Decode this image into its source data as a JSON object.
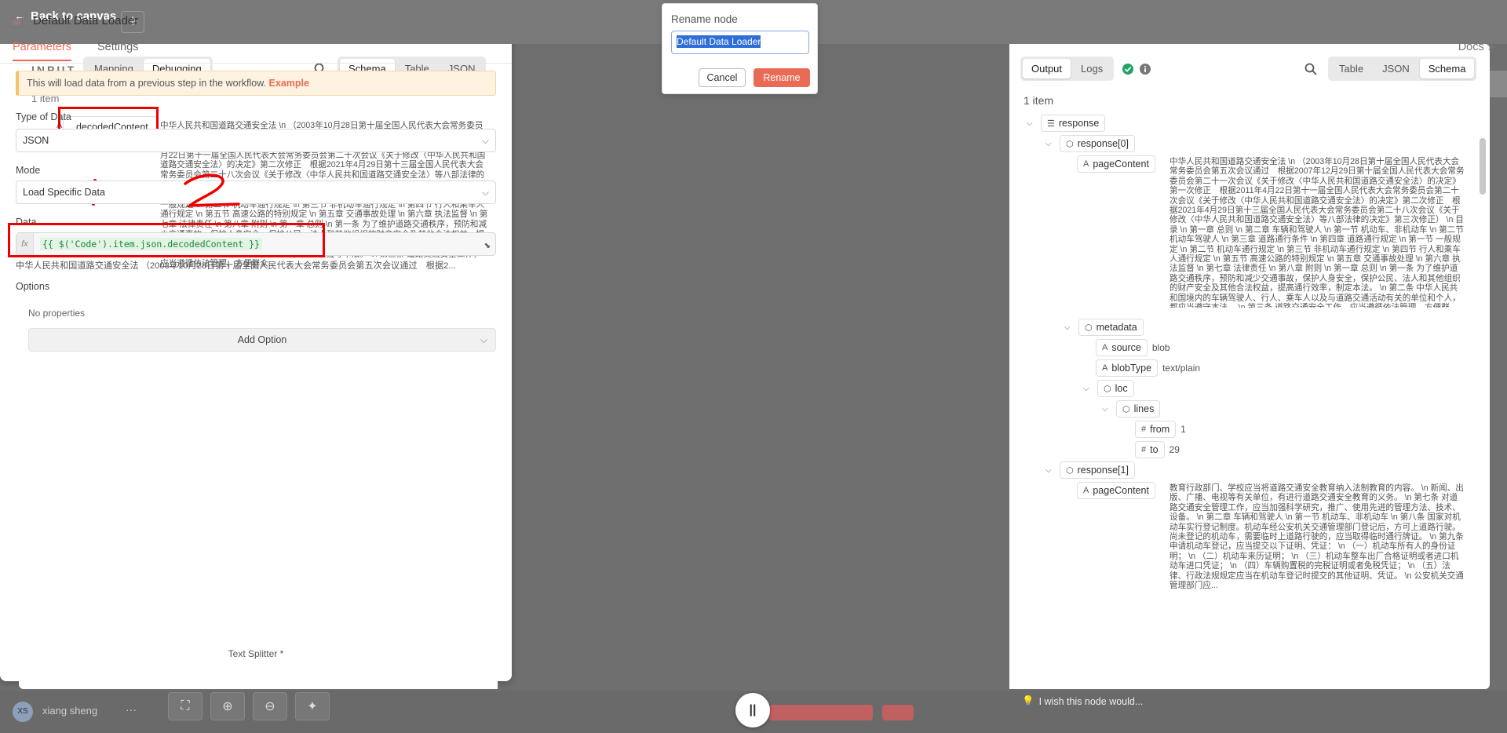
{
  "canvas": {
    "back_label": "Back to canvas",
    "add_label": "+",
    "user_initials": "XS",
    "user_name": "xiang sheng",
    "user_menu": "···",
    "wish_text": "I wish this node would..."
  },
  "input": {
    "title": "INPUT",
    "mode_tabs": [
      "Mapping",
      "Debugging"
    ],
    "active_mode": "Debugging",
    "view_tabs": [
      "Schema",
      "Table",
      "JSON"
    ],
    "active_view": "Schema",
    "item_count": "1 item",
    "key": "decodedContent",
    "value": "中华人民共和国道路交通安全法 \\n （2003年10月28日第十届全国人民代表大会常务委员会第五次会议通过　根据2007年12月29日第十届全国人民代表大会常务委员会第二十一次会议《关于修改〈中华人民共和国道路交通安全法〉的决定》第一次修正　根据2011年4月22日第十一届全国人民代表大会常务委员会第二十次会议《关于修改〈中华人民共和国道路交通安全法〉的决定》第二次修正　根据2021年4月29日第十三届全国人民代表大会常务委员会第二十八次会议《关于修改〈中华人民共和国道路交通安全法〉等八部法律的决定》第三次修正） \\n 目录 \\n 第一章 总则 \\n 第二章 车辆和驾驶人 \\n 第一节 机动车、非机动车 \\n 第二节 机动车驾驶人 \\n 第三章 道路通行条件 \\n 第四章 道路通行规定 \\n 第一节 一般规定 \\n 第二节 机动车通行规定 \\n 第三节 非机动车通行规定 \\n 第四节 行人和乘车人通行规定 \\n 第五节 高速公路的特别规定 \\n 第五章 交通事故处理 \\n 第六章 执法监督 \\n 第七章 法律责任 \\n 第八章 附则 \\n 第一章 总则 \\n 第一条 为了维护道路交通秩序，预防和减少交通事故，保护人身安全，保护公民、法人和其他组织的财产安全及其他合法权益，提高通行效率，制定本法。 \\n 第二条 中华人民共和国境内的车辆驾驶人、行人、乘车人以及与道路交通活动有关的单位和个人，都应当遵守本法。 \\n 第三条 道路交通安全工作，应当遵循依法管理、方便群众..."
  },
  "node": {
    "title": "Default Data Loader",
    "tabs": [
      "Parameters",
      "Settings"
    ],
    "active_tab": "Parameters",
    "docs_label": "Docs",
    "info_text": "This will load data from a previous step in the workflow.",
    "info_link": "Example",
    "type_label": "Type of Data",
    "type_value": "JSON",
    "mode_label": "Mode",
    "mode_value": "Load Specific Data",
    "data_label": "Data",
    "fx_label": "fx",
    "data_expression": "{{ $('Code').item.json.decodedContent }}",
    "data_preview": "中华人民共和国道路交通安全法 （2003年10月28日第十届全国人民代表大会常务委员会第五次会议通过　根据2...",
    "options_label": "Options",
    "no_props": "No properties",
    "add_option": "Add Option",
    "text_splitter": "Text Splitter *",
    "drag_handle": "||"
  },
  "rename": {
    "title": "Rename node",
    "value": "Default Data Loader",
    "cancel": "Cancel",
    "confirm": "Rename"
  },
  "output": {
    "tabs": [
      "Output",
      "Logs"
    ],
    "active_tab": "Output",
    "view_tabs": [
      "Table",
      "JSON",
      "Schema"
    ],
    "active_view": "Schema",
    "item_count": "1 item",
    "root": "response",
    "r0": "response[0]",
    "page_content_key": "pageContent",
    "r0_page_content": "中华人民共和国道路交通安全法 \\n （2003年10月28日第十届全国人民代表大会常务委员会第五次会议通过　根据2007年12月29日第十届全国人民代表大会常务委员会第二十一次会议《关于修改〈中华人民共和国道路交通安全法〉的决定》第一次修正　根据2011年4月22日第十一届全国人民代表大会常务委员会第二十次会议《关于修改〈中华人民共和国道路交通安全法〉的决定》第二次修正　根据2021年4月29日第十三届全国人民代表大会常务委员会第二十八次会议《关于修改〈中华人民共和国道路交通安全法〉等八部法律的决定》第三次修正） \\n 目录 \\n 第一章 总则 \\n 第二章 车辆和驾驶人 \\n 第一节 机动车、非机动车 \\n 第二节 机动车驾驶人 \\n 第三章 道路通行条件 \\n 第四章 道路通行规定 \\n 第一节 一般规定 \\n 第二节 机动车通行规定 \\n 第三节 非机动车通行规定 \\n 第四节 行人和乘车人通行规定 \\n 第五节 高速公路的特别规定 \\n 第五章 交通事故处理 \\n 第六章 执法监督 \\n 第七章 法律责任 \\n 第八章 附则 \\n 第一章 总则 \\n 第一条 为了维护道路交通秩序，预防和减少交通事故，保护人身安全，保护公民、法人和其他组织的财产安全及其他合法权益，提高通行效率，制定本法。 \\n 第二条 中华人民共和国境内的车辆驾驶人、行人、乘车人以及与道路交通活动有关的单位和个人，都应当遵守本法。 \\n 第三条 道路交通安全工作，应当遵循依法管理、方便群众...",
    "metadata": "metadata",
    "source_key": "source",
    "source_val": "blob",
    "blobtype_key": "blobType",
    "blobtype_val": "text/plain",
    "loc": "loc",
    "lines": "lines",
    "from_key": "from",
    "from_val": "1",
    "to_key": "to",
    "to_val": "29",
    "r1": "response[1]",
    "r1_page_content": "教育行政部门、学校应当将道路交通安全教育纳入法制教育的内容。 \\n 新闻、出版、广播、电视等有关单位，有进行道路交通安全教育的义务。 \\n 第七条 对道路交通安全管理工作，应当加强科学研究，推广、使用先进的管理方法、技术、设备。 \\n 第二章 车辆和驾驶人 \\n 第一节 机动车、非机动车 \\n 第八条 国家对机动车实行登记制度。机动车经公安机关交通管理部门登记后，方可上道路行驶。尚未登记的机动车，需要临时上道路行驶的，应当取得临时通行牌证。 \\n 第九条 申请机动车登记，应当提交以下证明、凭证： \\n （一）机动车所有人的身份证明； \\n （二）机动车来历证明； \\n （三）机动车整车出厂合格证明或者进口机动车进口凭证； \\n （四）车辆购置税的完税证明或者免税凭证； \\n （五）法律、行政法规规定应当在机动车登记时提交的其他证明、凭证。 \\n 公安机关交通管理部门应..."
  },
  "annotations": {
    "mark_1": "1",
    "mark_2": "2"
  },
  "colors": {
    "accent": "#ea6b55",
    "annotation": "#ee0000",
    "success": "#21a366"
  }
}
